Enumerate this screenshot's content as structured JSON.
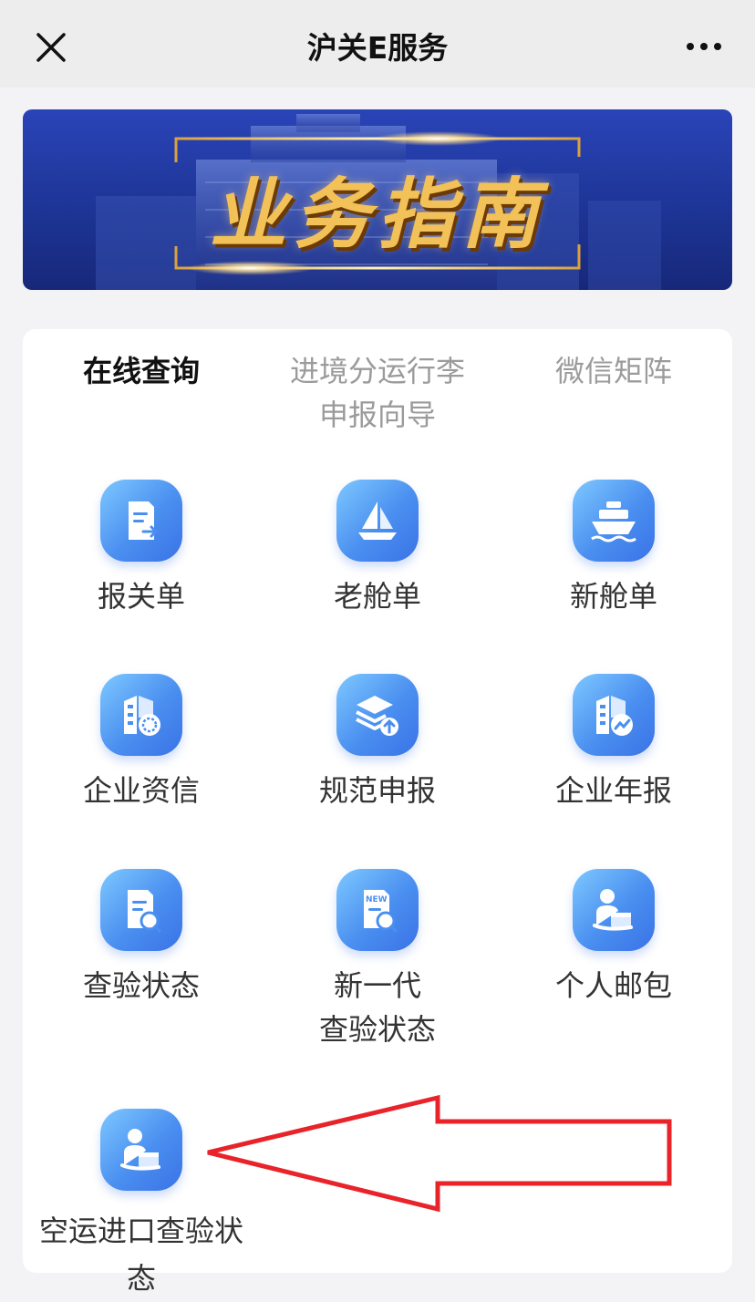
{
  "nav": {
    "title": "沪关E服务",
    "close_icon": "close-icon",
    "more_icon": "more-icon"
  },
  "banner": {
    "title": "业务指南"
  },
  "tabs": [
    {
      "label": "在线查询",
      "active": true
    },
    {
      "label": "进境分运行李申报向导",
      "line1": "进境分运行李",
      "line2": "申报向导",
      "active": false
    },
    {
      "label": "微信矩阵",
      "active": false
    }
  ],
  "tiles": [
    {
      "label": "报关单",
      "icon": "document-icon"
    },
    {
      "label": "老舱单",
      "icon": "sailboat-icon"
    },
    {
      "label": "新舱单",
      "icon": "ship-icon"
    },
    {
      "label": "企业资信",
      "icon": "building-credit-icon"
    },
    {
      "label": "规范申报",
      "icon": "layers-upload-icon"
    },
    {
      "label": "企业年报",
      "icon": "building-report-icon"
    },
    {
      "label": "查验状态",
      "icon": "document-search-icon"
    },
    {
      "label": "新一代查验状态",
      "line1": "新一代",
      "line2": "查验状态",
      "icon": "new-document-search-icon",
      "badge": "NEW"
    },
    {
      "label": "个人邮包",
      "icon": "person-parcel-icon"
    },
    {
      "label": "空运进口查验状态",
      "line1": "空运进口查验状",
      "line2": "态",
      "icon": "person-parcel-icon"
    }
  ],
  "colors": {
    "icon_gradient_start": "#7ec8ff",
    "icon_gradient_end": "#3a72e6",
    "annotation_arrow": "#e8232a",
    "banner_gold": "#f2c157",
    "banner_blue": "#1d3596"
  }
}
